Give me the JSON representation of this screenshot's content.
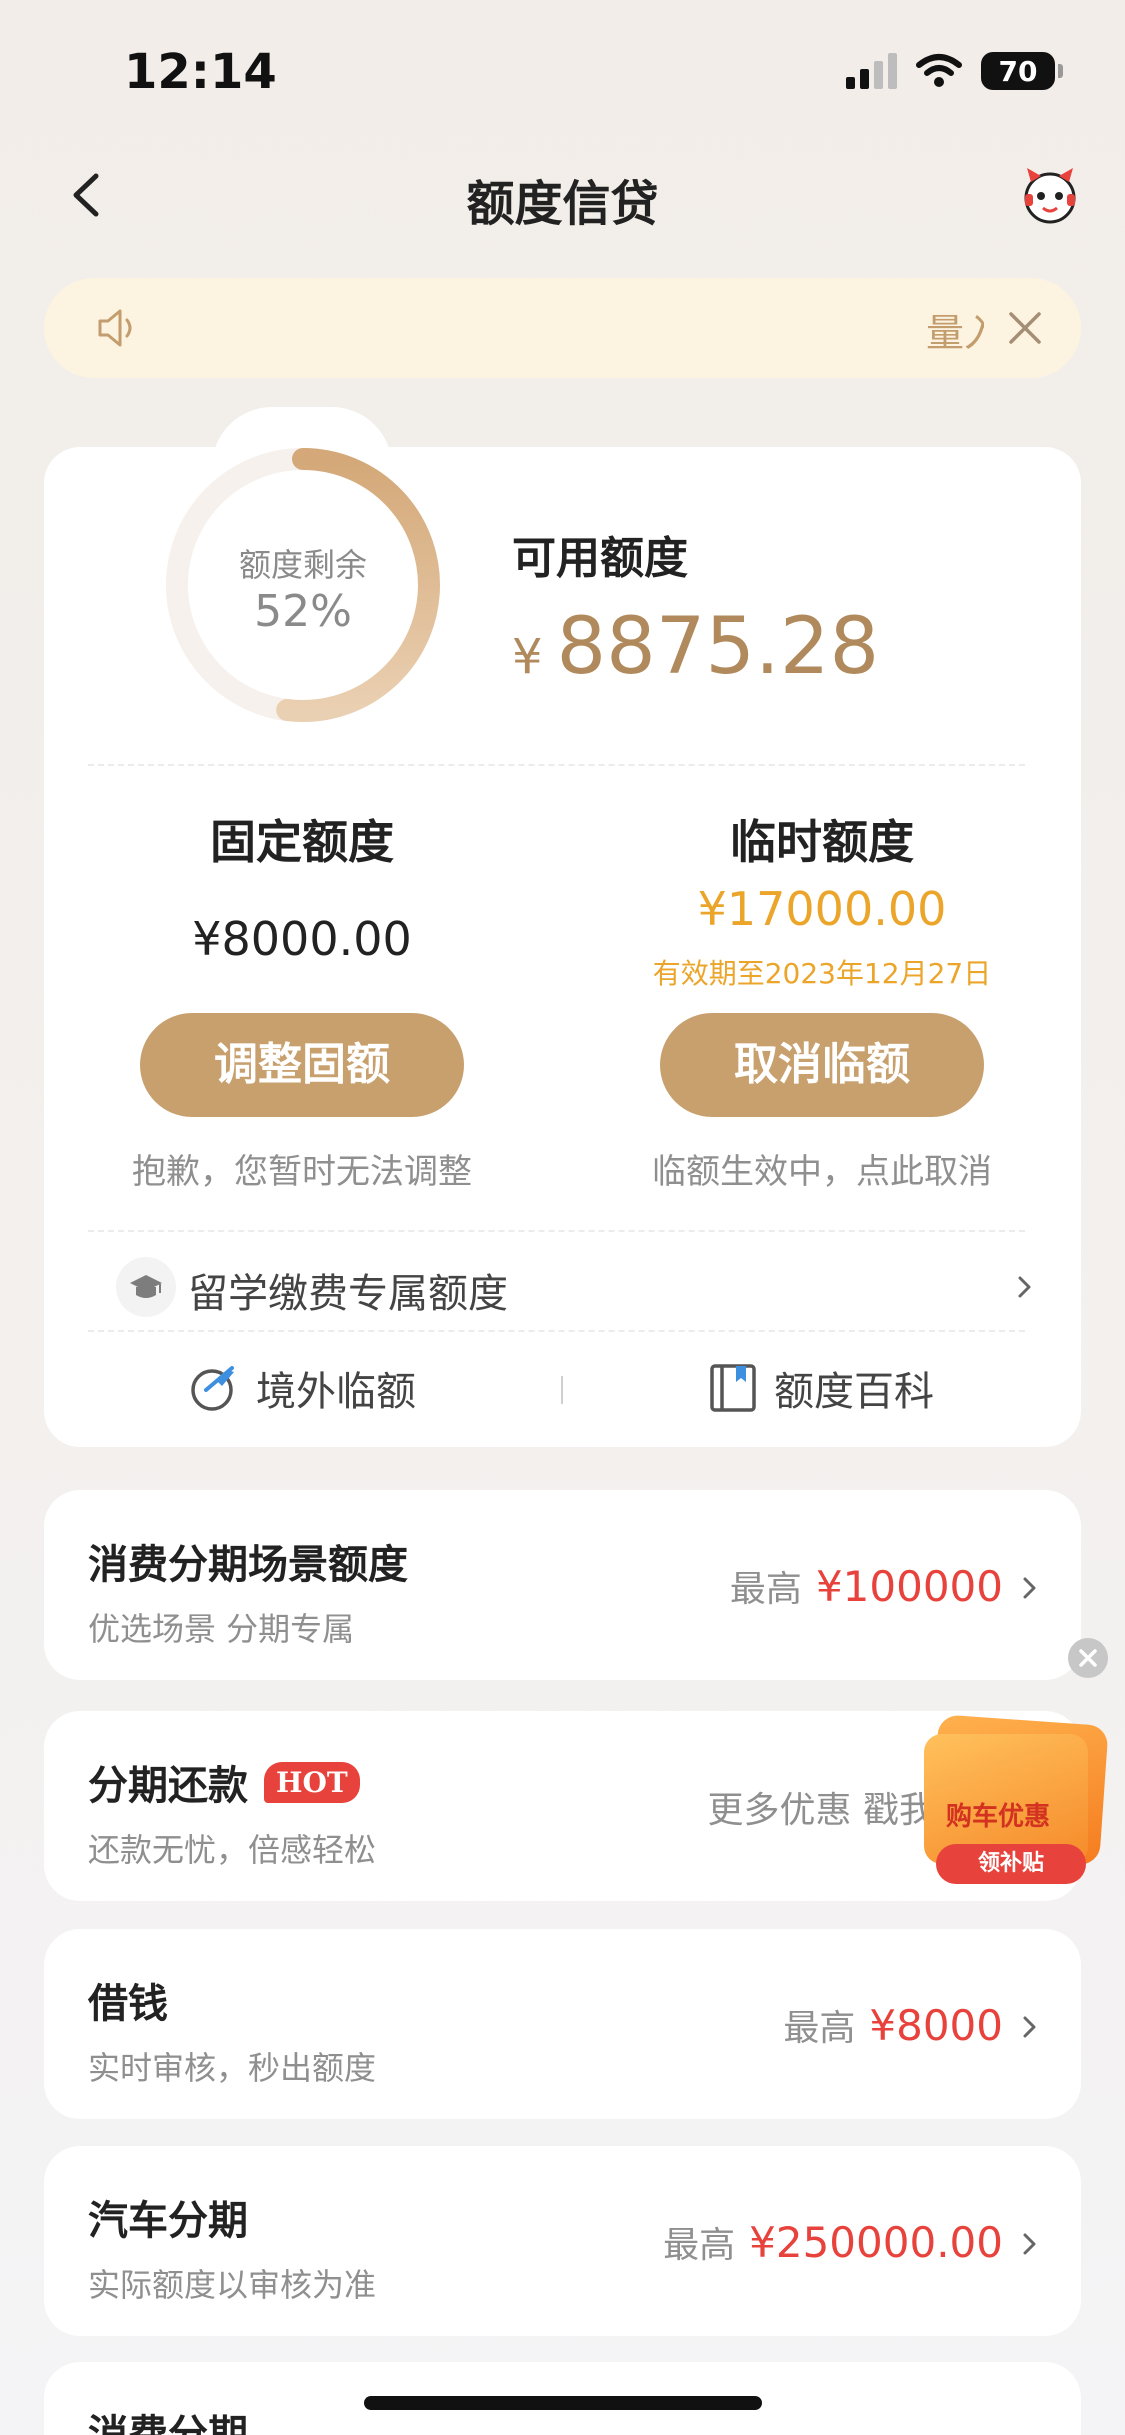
{
  "status_bar": {
    "time": "12:14",
    "battery": "70"
  },
  "nav": {
    "title": "额度信贷"
  },
  "notice": {
    "scroll_text": "量入"
  },
  "quota": {
    "ring_label": "额度剩余",
    "ring_percent": "52%",
    "remaining_fraction": 0.52,
    "available_label": "可用额度",
    "currency": "¥",
    "available_amount": "8875.28",
    "fixed": {
      "title": "固定额度",
      "amount": "¥8000.00",
      "button": "调整固额",
      "note": "抱歉，您暂时无法调整"
    },
    "temp": {
      "title": "临时额度",
      "amount": "¥17000.00",
      "expiry": "有效期至2023年12月27日",
      "button": "取消临额",
      "note": "临额生效中，点此取消"
    },
    "study": {
      "label": "留学缴费专属额度"
    },
    "links": {
      "overseas": "境外临额",
      "wiki": "额度百科"
    }
  },
  "rows": [
    {
      "title": "消费分期场景额度",
      "sub": "优选场景 分期专属",
      "prefix": "最高",
      "value": "¥100000"
    },
    {
      "title": "分期还款",
      "badge": "HOT",
      "sub": "还款无忧，倍感轻松",
      "prefix": "更多优惠 戳我",
      "value": ""
    },
    {
      "title": "借钱",
      "sub": "实时审核，秒出额度",
      "prefix": "最高",
      "value": "¥8000"
    },
    {
      "title": "汽车分期",
      "sub": "实际额度以审核为准",
      "prefix": "最高",
      "value": "¥250000.00"
    },
    {
      "title": "消费分期"
    }
  ],
  "promo": {
    "title": "购车优惠",
    "button": "领补贴"
  },
  "colors": {
    "gold": "#c8a06e",
    "amount_gold": "#b08a5c",
    "temp_orange": "#eba52b",
    "red": "#e8423c"
  }
}
